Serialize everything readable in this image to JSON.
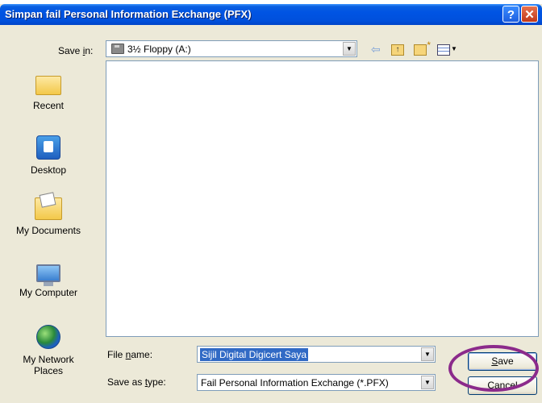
{
  "window": {
    "title": "Simpan fail Personal Information Exchange (PFX)",
    "help_label": "?",
    "close_label": "✕"
  },
  "save_in": {
    "label_prefix": "Save ",
    "label_mnemonic": "i",
    "label_suffix": "n:",
    "value": "3½ Floppy (A:)"
  },
  "toolbar": {
    "icons": [
      "back-icon",
      "up-folder-icon",
      "new-folder-icon",
      "views-icon"
    ]
  },
  "places": [
    {
      "label": "Recent",
      "icon": "recent-folder-icon"
    },
    {
      "label": "Desktop",
      "icon": "desktop-icon"
    },
    {
      "label": "My Documents",
      "icon": "my-documents-icon"
    },
    {
      "label": "My Computer",
      "icon": "my-computer-icon"
    },
    {
      "label": "My Network Places",
      "icon": "my-network-icon"
    }
  ],
  "form": {
    "filename_label_prefix": "File ",
    "filename_label_mnemonic": "n",
    "filename_label_suffix": "ame:",
    "filename_value": "Sijil Digital Digicert Saya",
    "savetype_label_prefix": "Save as ",
    "savetype_label_mnemonic": "t",
    "savetype_label_suffix": "ype:",
    "savetype_value": "Fail Personal Information Exchange (*.PFX)"
  },
  "buttons": {
    "save_mnemonic": "S",
    "save_rest": "ave",
    "cancel_label": "Cancel"
  },
  "colors": {
    "titlebar": "#0054e3",
    "dialog_bg": "#ece9d8",
    "selection": "#316ac5",
    "highlight_ring": "#8b2a8b"
  }
}
